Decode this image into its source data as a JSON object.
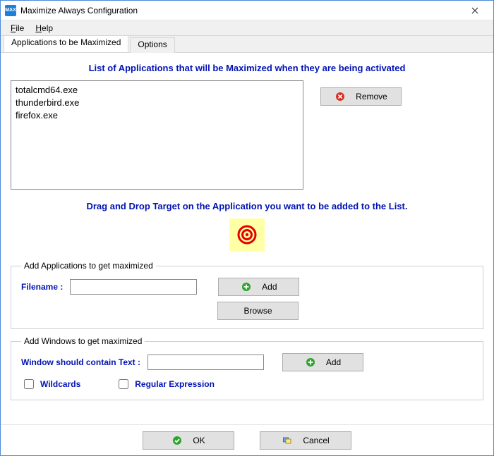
{
  "window": {
    "title": "Maximize Always Configuration"
  },
  "menu": {
    "file": "File",
    "help": "Help"
  },
  "tabs": {
    "applications": "Applications to be Maximized",
    "options": "Options"
  },
  "headings": {
    "list": "List of Applications that will be Maximized when they are being activated",
    "drag": "Drag and Drop Target on the Application you want to be added to the List."
  },
  "applist": [
    "totalcmd64.exe",
    "thunderbird.exe",
    "firefox.exe"
  ],
  "buttons": {
    "remove": "Remove",
    "add": "Add",
    "browse": "Browse",
    "add2": "Add",
    "ok": "OK",
    "cancel": "Cancel"
  },
  "groupbox": {
    "addapps": "Add Applications to get maximized",
    "addwin": "Add Windows to get maximized"
  },
  "labels": {
    "filename": "Filename :",
    "wintext": "Window should contain Text :",
    "wildcards": "Wildcards",
    "regex": "Regular Expression"
  },
  "inputs": {
    "filename": "",
    "wintext": ""
  },
  "checks": {
    "wildcards": false,
    "regex": false
  }
}
